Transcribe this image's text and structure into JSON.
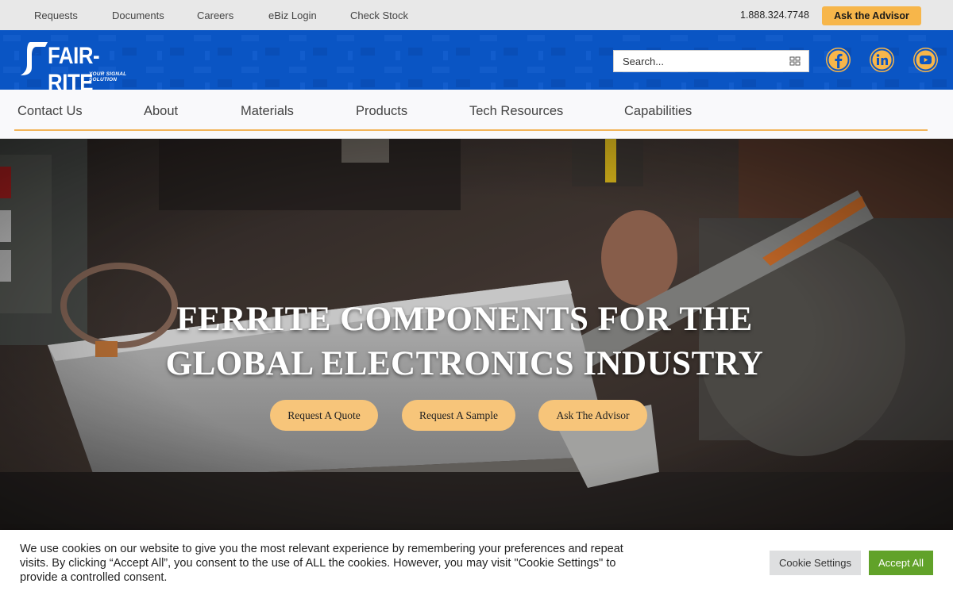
{
  "utility_nav": {
    "items": [
      "Requests",
      "Documents",
      "Careers",
      "eBiz Login",
      "Check Stock"
    ],
    "phone": "1.888.324.7748",
    "advisor_button": "Ask the Advisor"
  },
  "header": {
    "logo_text": "FAIR-RITE",
    "logo_tagline": "YOUR SIGNAL SOLUTION",
    "search": {
      "placeholder": "Search..."
    },
    "social": [
      "facebook-icon",
      "linkedin-icon",
      "youtube-icon"
    ]
  },
  "main_nav": {
    "items": [
      "Contact Us",
      "About",
      "Materials",
      "Products",
      "Tech Resources",
      "Capabilities"
    ]
  },
  "hero": {
    "title_line1": "FERRITE COMPONENTS FOR THE",
    "title_line2": "GLOBAL ELECTRONICS INDUSTRY",
    "buttons": [
      "Request A Quote",
      "Request A Sample",
      "Ask The Advisor"
    ]
  },
  "cookie_banner": {
    "text": "We use cookies on our website to give you the most relevant experience by remembering your preferences and repeat visits. By clicking “Accept All”, you consent to the use of ALL the cookies. However, you may visit \"Cookie Settings\" to provide a controlled consent.",
    "settings_button": "Cookie Settings",
    "accept_button": "Accept All"
  },
  "colors": {
    "header_blue": "#0a55c4",
    "accent_orange": "#f7b64a",
    "accept_green": "#61a229"
  }
}
